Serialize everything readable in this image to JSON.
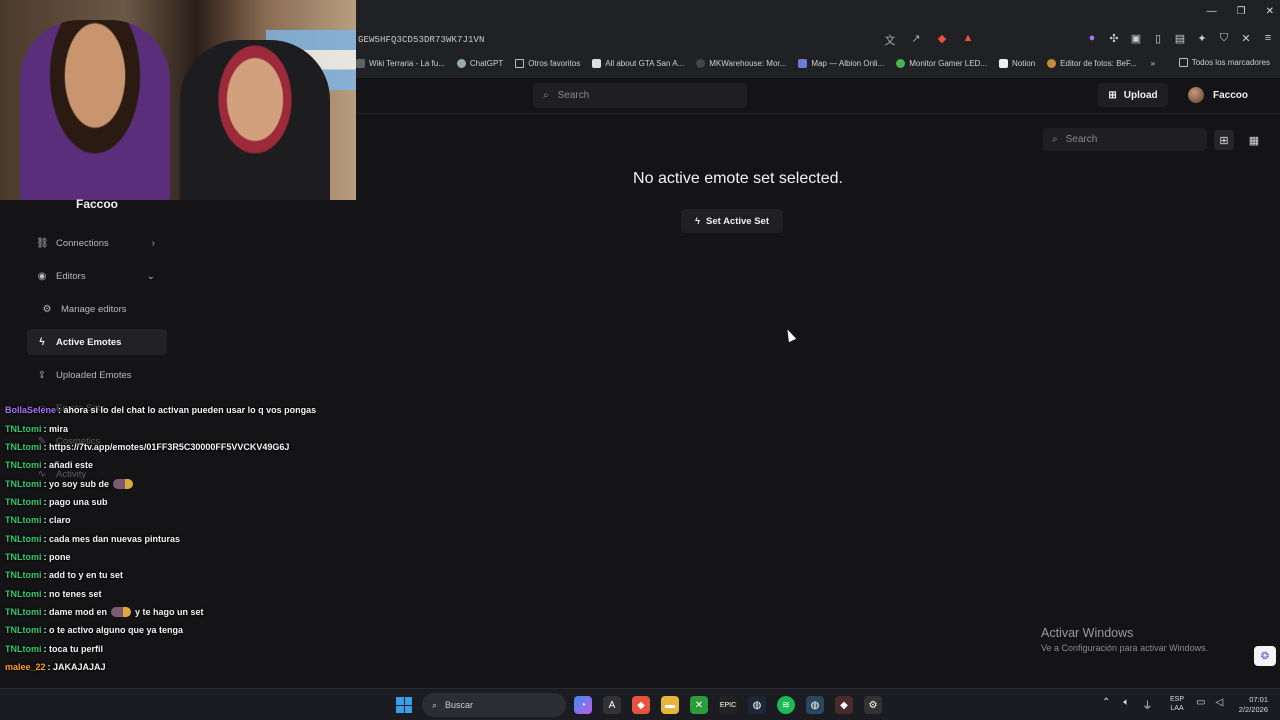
{
  "browser": {
    "url": "GEW5HFQ3CD53DR73WK7J1VN",
    "bookmarks": [
      {
        "label": "Wiki Terraria - La fu...",
        "icon": "site-icon"
      },
      {
        "label": "ChatGPT",
        "icon": "chatgpt-icon"
      },
      {
        "label": "Otros favoritos",
        "icon": "folder-icon"
      },
      {
        "label": "All about GTA San A...",
        "icon": "site-icon"
      },
      {
        "label": "MKWarehouse: Mor...",
        "icon": "site-icon"
      },
      {
        "label": "Map — Albion Onli...",
        "icon": "site-icon"
      },
      {
        "label": "Monitor Gamer LED...",
        "icon": "site-icon"
      },
      {
        "label": "Notion",
        "icon": "notion-icon"
      },
      {
        "label": "Editor de fotos: BeF...",
        "icon": "site-icon"
      }
    ],
    "bookmarks_more": "»",
    "all_bookmarks": "Todos los marcadores"
  },
  "header": {
    "search_placeholder": "Search",
    "upload_label": "Upload",
    "user_name": "Faccoo"
  },
  "overlay": {
    "streamer_name": "Faccoo"
  },
  "sidebar": {
    "items": [
      {
        "label": "Connections",
        "icon": "link-icon",
        "chevron": "›"
      },
      {
        "label": "Editors",
        "icon": "user-circle-icon",
        "chevron": "⌄"
      },
      {
        "label": "Manage editors",
        "icon": "gear-icon"
      },
      {
        "label": "Active Emotes",
        "icon": "bolt-icon"
      },
      {
        "label": "Uploaded Emotes",
        "icon": "upload-icon"
      },
      {
        "label": "Emote Sets",
        "icon": "folder-icon"
      },
      {
        "label": "Cosmetics",
        "icon": "brush-icon"
      },
      {
        "label": "Activity",
        "icon": "activity-icon"
      }
    ]
  },
  "main": {
    "empty_message": "No active emote set selected.",
    "set_active_label": "Set Active Set",
    "search_placeholder": "Search"
  },
  "chat": {
    "colors": {
      "purple": "#a970ff",
      "green": "#2ecc71",
      "orange": "#ff9f1a"
    },
    "messages": [
      {
        "user": "BollaSelene",
        "color": "#a970ff",
        "text": ": ahora si lo del chat lo activan pueden usar lo q vos pongas"
      },
      {
        "user": "TNLtomi",
        "color": "#2ecc71",
        "text": ": mira"
      },
      {
        "user": "TNLtomi",
        "color": "#2ecc71",
        "text": ": https://7tv.app/emotes/01FF3R5C30000FF5VVCKV49G6J"
      },
      {
        "user": "TNLtomi",
        "color": "#2ecc71",
        "text": ": añadi este"
      },
      {
        "user": "TNLtomi",
        "color": "#2ecc71",
        "text": ": yo soy sub de",
        "emote": true
      },
      {
        "user": "TNLtomi",
        "color": "#2ecc71",
        "text": ": pago una sub"
      },
      {
        "user": "TNLtomi",
        "color": "#2ecc71",
        "text": ": claro"
      },
      {
        "user": "TNLtomi",
        "color": "#2ecc71",
        "text": ": cada mes dan nuevas pinturas"
      },
      {
        "user": "TNLtomi",
        "color": "#2ecc71",
        "text": ": pone"
      },
      {
        "user": "TNLtomi",
        "color": "#2ecc71",
        "text": ": add to y en tu set"
      },
      {
        "user": "TNLtomi",
        "color": "#2ecc71",
        "text": ": no tenes set"
      },
      {
        "user": "TNLtomi",
        "color": "#2ecc71",
        "text": ": dame mod en",
        "emote": true,
        "after": "y te hago un set"
      },
      {
        "user": "TNLtomi",
        "color": "#2ecc71",
        "text": ": o te activo alguno que ya tenga"
      },
      {
        "user": "TNLtomi",
        "color": "#2ecc71",
        "text": ": toca tu perfil"
      },
      {
        "user": "malee_22",
        "color": "#ff9f1a",
        "text": ": JAKAJAJAJ"
      }
    ]
  },
  "watermark": {
    "title": "Activar Windows",
    "subtitle": "Ve a Configuración para activar Windows."
  },
  "taskbar": {
    "search_label": "Buscar",
    "lang_top": "ESP",
    "lang_bottom": "LAA",
    "time": "07:01",
    "date": "2/2/2026"
  }
}
